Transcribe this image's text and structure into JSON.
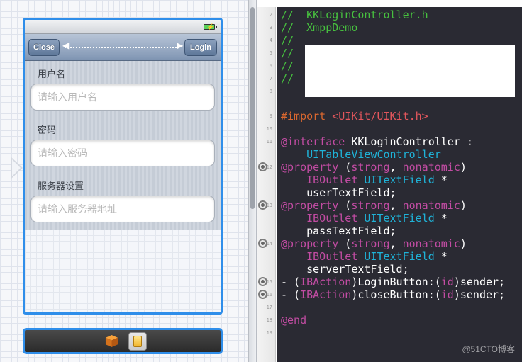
{
  "ib": {
    "nav": {
      "close_label": "Close",
      "login_label": "Login"
    },
    "fields": [
      {
        "label": "用户名",
        "placeholder": "请输入用户名"
      },
      {
        "label": "密码",
        "placeholder": "请输入密码"
      },
      {
        "label": "服务器设置",
        "placeholder": "请输入服务器地址"
      }
    ],
    "dock": {
      "icons": [
        "first-responder-cube-icon",
        "view-controller-icon"
      ]
    }
  },
  "editor": {
    "lines": [
      {
        "num": "2",
        "parts": [
          {
            "t": "//  KKLoginController.h",
            "c": "comment"
          }
        ]
      },
      {
        "num": "3",
        "parts": [
          {
            "t": "//  XmppDemo",
            "c": "comment"
          }
        ]
      },
      {
        "num": "4",
        "parts": [
          {
            "t": "//",
            "c": "comment"
          }
        ]
      },
      {
        "num": "5",
        "parts": [
          {
            "t": "//",
            "c": "comment"
          }
        ]
      },
      {
        "num": "6",
        "parts": [
          {
            "t": "//",
            "c": "comment"
          }
        ]
      },
      {
        "num": "7",
        "parts": [
          {
            "t": "//",
            "c": "comment"
          }
        ]
      },
      {
        "num": "8",
        "parts": []
      },
      {
        "num": "9",
        "parts": [
          {
            "t": "#import ",
            "c": "pre"
          },
          {
            "t": "<UIKit/UIKit.h>",
            "c": "str"
          }
        ]
      },
      {
        "num": "10",
        "parts": []
      },
      {
        "num": "11",
        "parts": [
          {
            "t": "@interface",
            "c": "kw"
          },
          {
            "t": " KKLoginController :",
            "c": "plain"
          }
        ]
      },
      {
        "num": "",
        "parts": [
          {
            "t": "    UITableViewController",
            "c": "type"
          }
        ]
      },
      {
        "num": "12",
        "parts": [
          {
            "t": "@property",
            "c": "kw"
          },
          {
            "t": " (",
            "c": "plain"
          },
          {
            "t": "strong",
            "c": "kw"
          },
          {
            "t": ", ",
            "c": "plain"
          },
          {
            "t": "nonatomic",
            "c": "kw"
          },
          {
            "t": ")",
            "c": "plain"
          }
        ]
      },
      {
        "num": "",
        "parts": [
          {
            "t": "    ",
            "c": "plain"
          },
          {
            "t": "IBOutlet",
            "c": "kw"
          },
          {
            "t": " ",
            "c": "plain"
          },
          {
            "t": "UITextField",
            "c": "type"
          },
          {
            "t": " *",
            "c": "plain"
          }
        ]
      },
      {
        "num": "",
        "parts": [
          {
            "t": "    userTextField;",
            "c": "plain"
          }
        ]
      },
      {
        "num": "13",
        "parts": [
          {
            "t": "@property",
            "c": "kw"
          },
          {
            "t": " (",
            "c": "plain"
          },
          {
            "t": "strong",
            "c": "kw"
          },
          {
            "t": ", ",
            "c": "plain"
          },
          {
            "t": "nonatomic",
            "c": "kw"
          },
          {
            "t": ")",
            "c": "plain"
          }
        ]
      },
      {
        "num": "",
        "parts": [
          {
            "t": "    ",
            "c": "plain"
          },
          {
            "t": "IBOutlet",
            "c": "kw"
          },
          {
            "t": " ",
            "c": "plain"
          },
          {
            "t": "UITextField",
            "c": "type"
          },
          {
            "t": " *",
            "c": "plain"
          }
        ]
      },
      {
        "num": "",
        "parts": [
          {
            "t": "    passTextField;",
            "c": "plain"
          }
        ]
      },
      {
        "num": "14",
        "parts": [
          {
            "t": "@property",
            "c": "kw"
          },
          {
            "t": " (",
            "c": "plain"
          },
          {
            "t": "strong",
            "c": "kw"
          },
          {
            "t": ", ",
            "c": "plain"
          },
          {
            "t": "nonatomic",
            "c": "kw"
          },
          {
            "t": ")",
            "c": "plain"
          }
        ]
      },
      {
        "num": "",
        "parts": [
          {
            "t": "    ",
            "c": "plain"
          },
          {
            "t": "IBOutlet",
            "c": "kw"
          },
          {
            "t": " ",
            "c": "plain"
          },
          {
            "t": "UITextField",
            "c": "type"
          },
          {
            "t": " *",
            "c": "plain"
          }
        ]
      },
      {
        "num": "",
        "parts": [
          {
            "t": "    serverTextField;",
            "c": "plain"
          }
        ]
      },
      {
        "num": "15",
        "parts": [
          {
            "t": "- (",
            "c": "plain"
          },
          {
            "t": "IBAction",
            "c": "kw"
          },
          {
            "t": ")LoginButton:(",
            "c": "plain"
          },
          {
            "t": "id",
            "c": "kw"
          },
          {
            "t": ")sender;",
            "c": "plain"
          }
        ]
      },
      {
        "num": "16",
        "parts": [
          {
            "t": "- (",
            "c": "plain"
          },
          {
            "t": "IBAction",
            "c": "kw"
          },
          {
            "t": ")closeButton:(",
            "c": "plain"
          },
          {
            "t": "id",
            "c": "kw"
          },
          {
            "t": ")sender;",
            "c": "plain"
          }
        ]
      },
      {
        "num": "17",
        "parts": []
      },
      {
        "num": "18",
        "parts": [
          {
            "t": "@end",
            "c": "kw"
          }
        ]
      },
      {
        "num": "19",
        "parts": []
      }
    ],
    "outlet_rows": [
      12,
      13,
      14,
      15,
      16
    ]
  },
  "watermark": "@51CTO博客",
  "colors": {
    "selection_blue": "#2f8eea",
    "editor_bg": "#2a2a33",
    "comment": "#47c03f",
    "keyword": "#c24ca3",
    "type": "#1fb2d7",
    "string": "#e2565c",
    "preprocessor": "#d9672f"
  }
}
